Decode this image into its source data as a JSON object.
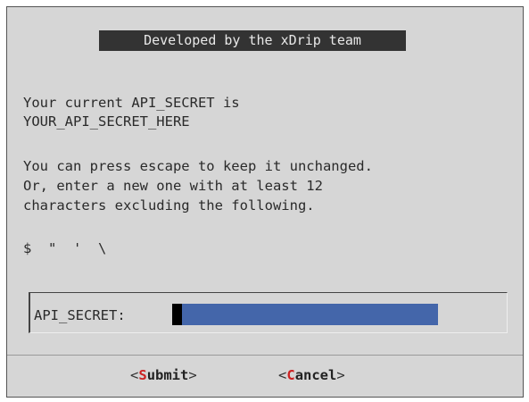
{
  "title": "Developed by the xDrip team",
  "message": {
    "line1": "Your current API_SECRET is",
    "line2": "YOUR_API_SECRET_HERE",
    "line3": "You can press escape to keep it unchanged.",
    "line4": "Or, enter a new one with at least 12",
    "line5": "characters excluding the following.",
    "line6": "$  \"  '  \\"
  },
  "input": {
    "label": "API_SECRET:",
    "value": ""
  },
  "buttons": {
    "submit": {
      "open": "<",
      "hotkey": "S",
      "rest": "ubmit",
      "close": ">"
    },
    "cancel": {
      "open": "<",
      "hotkey": "C",
      "rest": "ancel",
      "close": ">"
    }
  },
  "colors": {
    "background": "#d6d6d6",
    "title_bg": "#333333",
    "input_bg": "#4466aa",
    "hotkey": "#cc2222"
  }
}
